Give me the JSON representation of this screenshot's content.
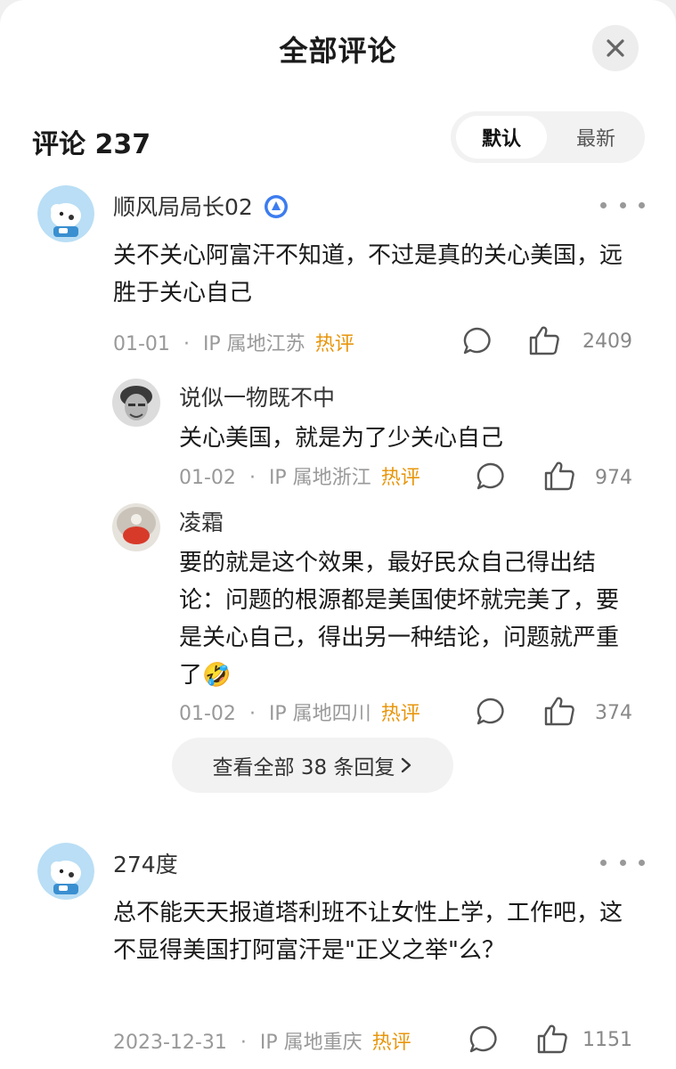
{
  "header": {
    "title": "全部评论"
  },
  "toolbar": {
    "count_title": "评论 237",
    "sort_default": "默认",
    "sort_latest": "最新"
  },
  "comments": [
    {
      "user": "顺风局局长02",
      "text": "关不关心阿富汗不知道，不过是真的关心美国，远胜于关心自己",
      "date": "01-01",
      "ip": "IP 属地江苏",
      "tag": "热评",
      "likes": "2409",
      "replies": [
        {
          "user": "说似一物既不中",
          "text": "关心美国，就是为了少关心自己",
          "date": "01-02",
          "ip": "IP 属地浙江",
          "tag": "热评",
          "likes": "974"
        },
        {
          "user": "凌霜",
          "text": "要的就是这个效果，最好民众自己得出结论：问题的根源都是美国使坏就完美了，要是关心自己，得出另一种结论，问题就严重了",
          "emoji": "🤣",
          "date": "01-02",
          "ip": "IP 属地四川",
          "tag": "热评",
          "likes": "374"
        }
      ],
      "view_all": "查看全部 38 条回复"
    },
    {
      "user": "274度",
      "text": "总不能天天报道塔利班不让女性上学，工作吧，这不显得美国打阿富汗是\"正义之举\"么？",
      "date": "2023-12-31",
      "ip": "IP 属地重庆",
      "tag": "热评",
      "likes": "1151"
    }
  ],
  "meta_separator": "·",
  "icons": [
    "close-icon",
    "verified-badge-icon",
    "more-icon",
    "comment-icon",
    "like-icon",
    "chevron-right-icon"
  ],
  "colors": {
    "hot_tag": "#e8960c",
    "meta": "#999999",
    "badge": "#3d7cf0"
  }
}
